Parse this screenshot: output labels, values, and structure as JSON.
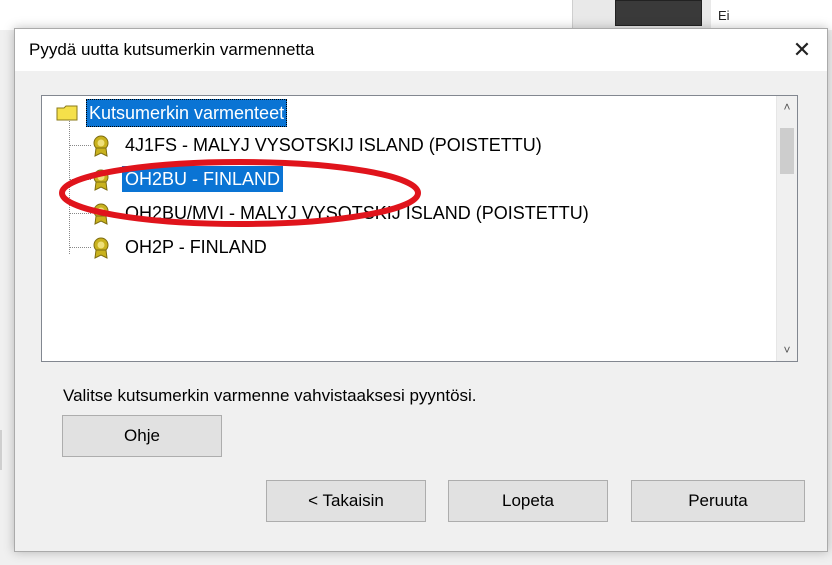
{
  "background": {
    "partial_text": "Ei"
  },
  "dialog": {
    "title": "Pyydä uutta kutsumerkin varmennetta",
    "close_symbol": "✕"
  },
  "tree": {
    "root": {
      "label": "Kutsumerkin varmenteet",
      "icon": "folder-icon"
    },
    "items": [
      {
        "label": "4J1FS - MALYJ VYSOTSKIJ ISLAND (POISTETTU)",
        "icon": "certificate-icon",
        "selected": false
      },
      {
        "label": "OH2BU - FINLAND",
        "icon": "certificate-icon",
        "selected": true
      },
      {
        "label": "OH2BU/MVI - MALYJ VYSOTSKIJ ISLAND (POISTETTU)",
        "icon": "certificate-icon",
        "selected": false
      },
      {
        "label": "OH2P - FINLAND",
        "icon": "certificate-icon",
        "selected": false
      }
    ],
    "scroll_up": "˄",
    "scroll_down": "˅"
  },
  "hint": "Valitse kutsumerkin varmenne vahvistaaksesi pyyntösi.",
  "buttons": {
    "help": "Ohje",
    "back": "< Takaisin",
    "finish": "Lopeta",
    "cancel": "Peruuta"
  },
  "colors": {
    "selection": "#0a74d4",
    "annotation": "#e0141c",
    "folder": "#f5e04a",
    "certificate": "#c9b21e"
  }
}
